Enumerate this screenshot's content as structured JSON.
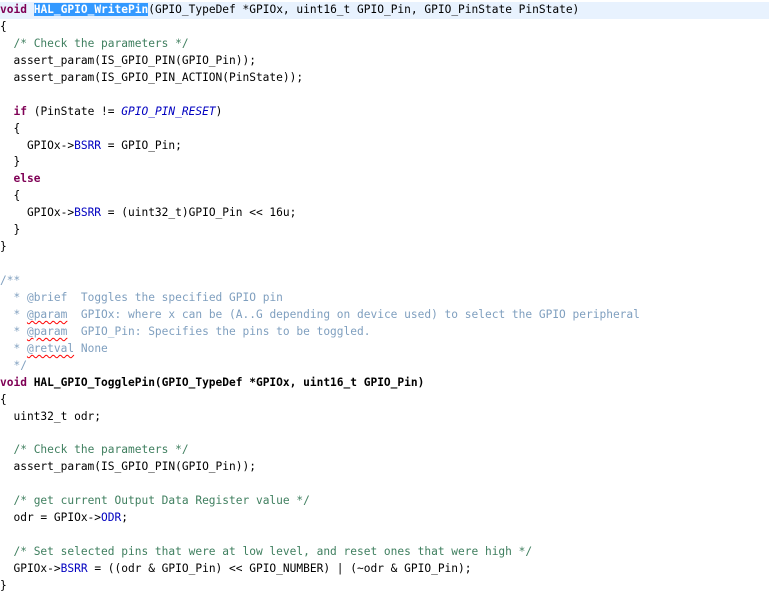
{
  "lines": [
    [
      "void",
      " ",
      "HAL_GPIO_WritePin",
      "(GPIO_TypeDef *GPIOx, uint16_t GPIO_Pin, GPIO_PinState PinState)"
    ],
    [
      "{"
    ],
    [
      "  ",
      "/* Check the parameters */"
    ],
    [
      "  assert_param(IS_GPIO_PIN(GPIO_Pin));"
    ],
    [
      "  assert_param(IS_GPIO_PIN_ACTION(PinState));"
    ],
    [
      ""
    ],
    [
      "  ",
      "if",
      " (PinState != ",
      "GPIO_PIN_RESET",
      ")"
    ],
    [
      "  {"
    ],
    [
      "    GPIOx->",
      "BSRR",
      " = GPIO_Pin;"
    ],
    [
      "  }"
    ],
    [
      "  ",
      "else"
    ],
    [
      "  {"
    ],
    [
      "    GPIOx->",
      "BSRR",
      " = (uint32_t)GPIO_Pin << 16u;"
    ],
    [
      "  }"
    ],
    [
      "}"
    ],
    [
      ""
    ],
    [
      "/**"
    ],
    [
      "  * ",
      "@brief",
      "  Toggles the specified GPIO pin"
    ],
    [
      "  * ",
      "@param",
      "  GPIOx: where x can be (A..G depending on device used) to select the GPIO peripheral"
    ],
    [
      "  * ",
      "@param",
      "  GPIO_Pin: Specifies the pins to be toggled."
    ],
    [
      "  * ",
      "@retval",
      " None"
    ],
    [
      "  */"
    ],
    [
      "void",
      " HAL_GPIO_TogglePin(GPIO_TypeDef *GPIOx, uint16_t GPIO_Pin)"
    ],
    [
      "{"
    ],
    [
      "  uint32_t odr;"
    ],
    [
      ""
    ],
    [
      "  ",
      "/* Check the parameters */"
    ],
    [
      "  assert_param(IS_GPIO_PIN(GPIO_Pin));"
    ],
    [
      ""
    ],
    [
      "  ",
      "/* get current Output Data Register value */"
    ],
    [
      "  odr = GPIOx->",
      "ODR",
      ";"
    ],
    [
      ""
    ],
    [
      "  ",
      "/* Set selected pins that were at low level, and reset ones that were high */"
    ],
    [
      "  GPIOx->",
      "BSRR",
      " = ((odr & GPIO_Pin) << GPIO_NUMBER) | (~odr & GPIO_Pin);"
    ],
    [
      "}"
    ]
  ]
}
